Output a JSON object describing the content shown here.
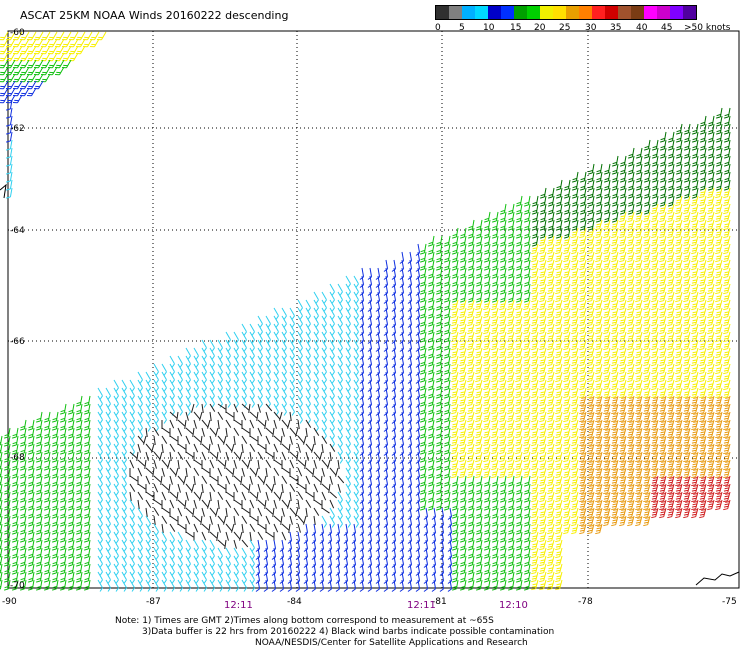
{
  "title": "ASCAT 25KM NOAA Winds 20160222 descending",
  "legend": {
    "colors": [
      "#303030",
      "#808080",
      "#00b0ff",
      "#00d8ff",
      "#0000c8",
      "#0030ff",
      "#00a000",
      "#00d000",
      "#f0f000",
      "#ffe000",
      "#e8a000",
      "#ff8000",
      "#ff2020",
      "#d00000",
      "#a0522d",
      "#7a3c14",
      "#ff00ff",
      "#cc00cc",
      "#8000ff",
      "#5000a0"
    ],
    "ticks": [
      "0",
      "5",
      "10",
      "15",
      "20",
      "25",
      "30",
      "35",
      "40",
      "45",
      ">50 knots"
    ]
  },
  "map": {
    "lat_labels": [
      "-60",
      "-62",
      "-64",
      "-66",
      "-68",
      "-70"
    ],
    "lon_labels": [
      "-90",
      "-87",
      "-84",
      "-81",
      "-78",
      "-75"
    ],
    "time_labels": [
      "12:11",
      "12:11",
      "12:10"
    ],
    "barb_colors": {
      "black": "#202020",
      "lightblue": "#30d0f0",
      "blue": "#1030e0",
      "green": "#10c010",
      "darkgreen": "#007000",
      "yellow": "#f8f000",
      "orange": "#e89a10",
      "red": "#d02020"
    }
  },
  "notes": {
    "line1": "Note: 1) Times are GMT 2)Times along bottom correspond to measurement at ~65S",
    "line2": "3)Data buffer is 22 hrs from 20160222 4) Black wind barbs indicate possible contamination",
    "line3": "NOAA/NESDIS/Center for Satellite Applications and Research"
  }
}
